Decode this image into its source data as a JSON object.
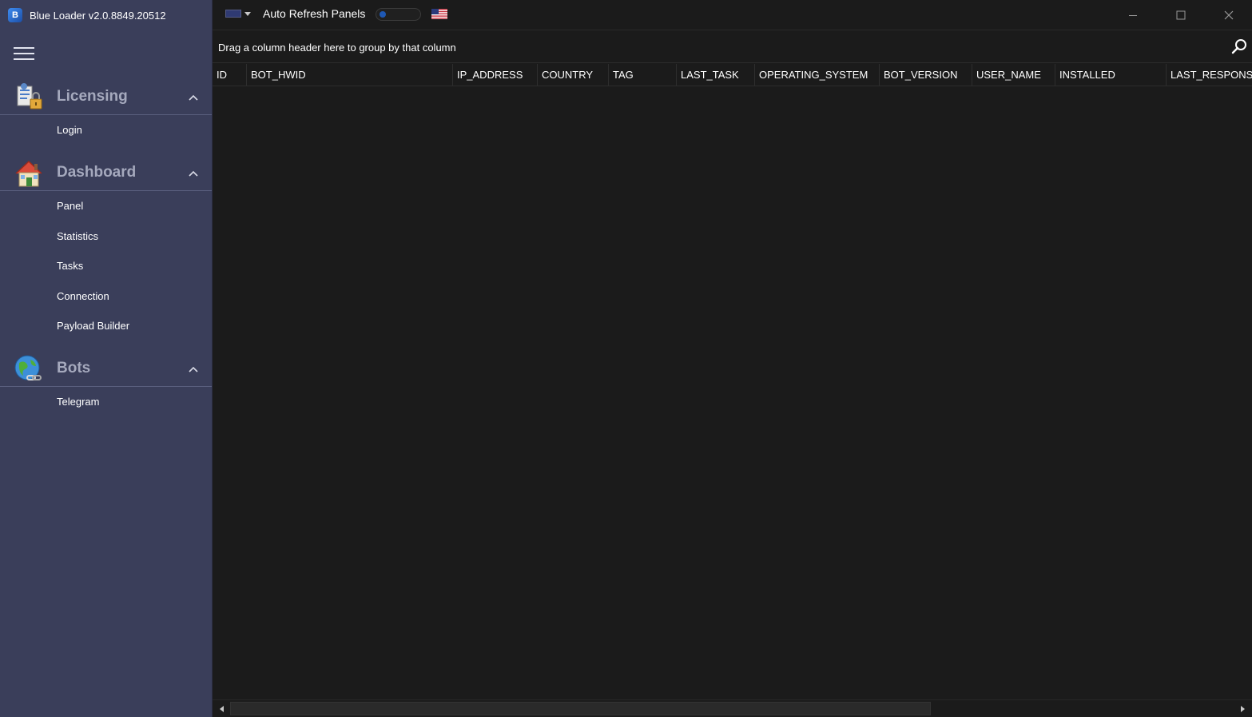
{
  "app": {
    "title": "Blue Loader v2.0.8849.20512",
    "logo_letter": "B"
  },
  "sidebar": {
    "sections": [
      {
        "label": "Licensing",
        "icon": "licensing-icon",
        "items": [
          "Login"
        ]
      },
      {
        "label": "Dashboard",
        "icon": "home-icon",
        "items": [
          "Panel",
          "Statistics",
          "Tasks",
          "Connection",
          "Payload Builder"
        ]
      },
      {
        "label": "Bots",
        "icon": "globe-icon",
        "items": [
          "Telegram"
        ]
      }
    ]
  },
  "topbar": {
    "auto_refresh_label": "Auto Refresh Panels",
    "auto_refresh_on": false,
    "language_flag": "us-flag-icon"
  },
  "grid": {
    "group_panel_text": "Drag a column header here to group by that column",
    "columns": [
      "ID",
      "BOT_HWID",
      "IP_ADDRESS",
      "COUNTRY",
      "TAG",
      "LAST_TASK",
      "OPERATING_SYSTEM",
      "BOT_VERSION",
      "USER_NAME",
      "INSTALLED",
      "LAST_RESPONSE"
    ],
    "rows": []
  },
  "colors": {
    "sidebar_bg": "#3a3e5a",
    "main_bg": "#1b1b1b",
    "accent": "#1e58b4"
  }
}
